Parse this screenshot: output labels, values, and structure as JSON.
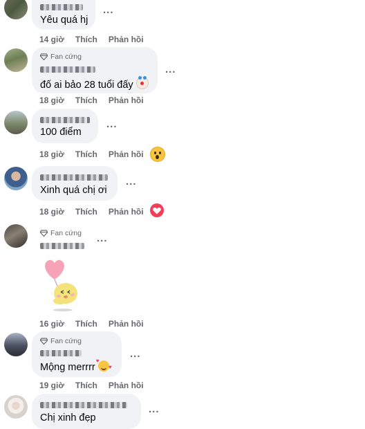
{
  "comments": [
    {
      "text": "Yêu quá hj",
      "time": "14 giờ",
      "like": "Thích",
      "reply": "Phản hồi"
    },
    {
      "badge": "Fan cứng",
      "text": "đố ai bảo 28 tuổi đấy",
      "time": "18 giờ",
      "like": "Thích",
      "reply": "Phản hồi",
      "emoji": "clown-face"
    },
    {
      "text": "100 điểm",
      "time": "18 giờ",
      "like": "Thích",
      "reply": "Phản hồi",
      "reaction": "wow"
    },
    {
      "text": "Xinh quá chị ơi",
      "time": "18 giờ",
      "like": "Thích",
      "reply": "Phản hồi",
      "reaction": "love"
    },
    {
      "badge": "Fan cứng",
      "sticker": "heart-balloon-chick",
      "time": "16 giờ",
      "like": "Thích",
      "reply": "Phản hồi"
    },
    {
      "badge": "Fan cứng",
      "text": "Mộng merrrr",
      "time": "19 giờ",
      "like": "Thích",
      "reply": "Phản hồi",
      "emoji": "smiling-face-with-hearts"
    },
    {
      "text": "Chị xinh đẹp"
    }
  ],
  "more_label": "..."
}
